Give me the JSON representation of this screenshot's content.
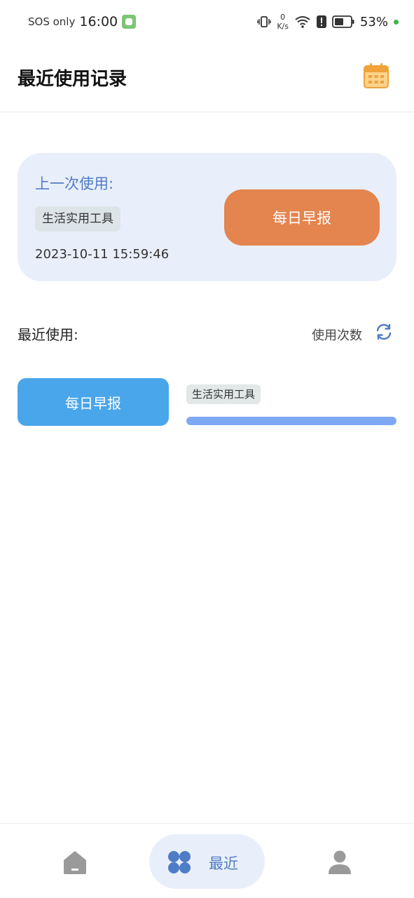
{
  "status_bar": {
    "carrier": "SOS only",
    "time": "16:00",
    "speed_value": "0",
    "speed_unit": "K/s",
    "battery": "53%"
  },
  "header": {
    "title": "最近使用记录",
    "calendar_icon": "calendar-icon"
  },
  "last_used": {
    "label": "上一次使用:",
    "category": "生活实用工具",
    "time": "2023-10-11 15:59:46",
    "tool_name": "每日早报"
  },
  "recent": {
    "label": "最近使用:",
    "sort_label": "使用次数",
    "items": [
      {
        "tool_name": "每日早报",
        "category": "生活实用工具",
        "usage_fraction": 1.0
      }
    ]
  },
  "bottom_nav": {
    "items": [
      {
        "icon": "home-icon",
        "label": ""
      },
      {
        "icon": "grid-icon",
        "label": "最近",
        "active": true
      },
      {
        "icon": "profile-icon",
        "label": ""
      }
    ]
  },
  "colors": {
    "accent_blue": "#4f7cc6",
    "orange": "#e4844f",
    "sky_blue": "#4aa6ea",
    "bar_blue": "#7ea8f4",
    "card_bg": "#e9effa"
  }
}
